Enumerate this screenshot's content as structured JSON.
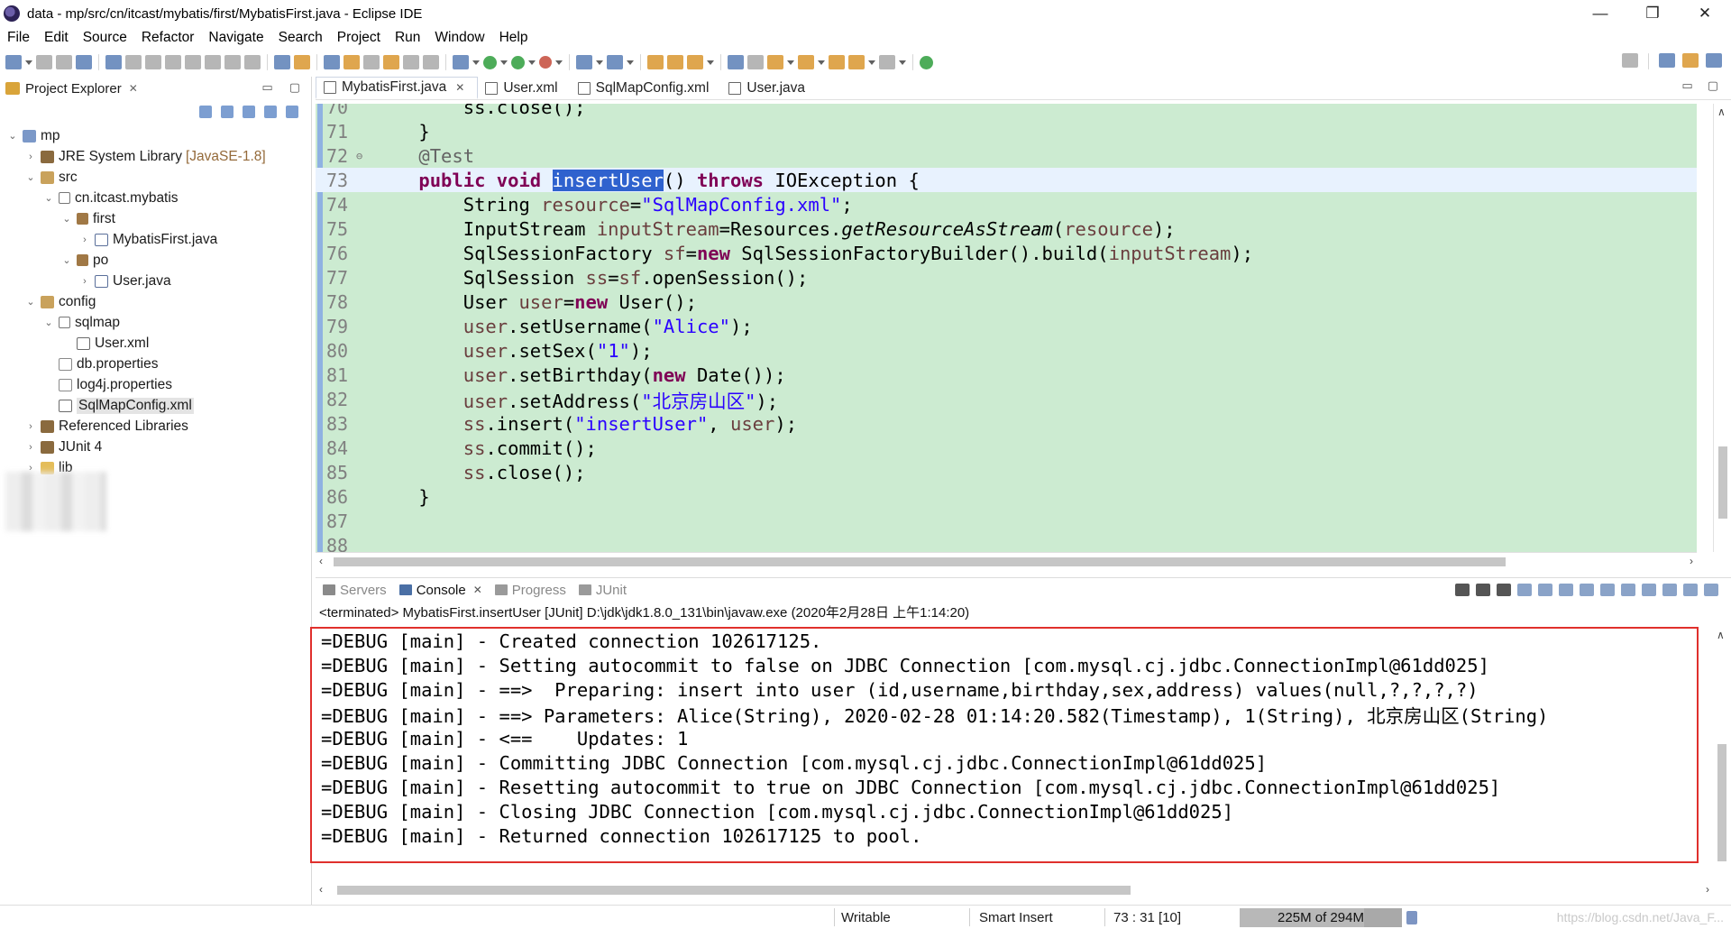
{
  "window": {
    "title": "data - mp/src/cn/itcast/mybatis/first/MybatisFirst.java - Eclipse IDE",
    "minimize": "—",
    "restore": "❐",
    "close": "✕"
  },
  "menu": [
    "File",
    "Edit",
    "Source",
    "Refactor",
    "Navigate",
    "Search",
    "Project",
    "Run",
    "Window",
    "Help"
  ],
  "explorer": {
    "title": "Project Explorer",
    "items": [
      {
        "label": "mp",
        "indent": 0,
        "twisty": "v",
        "icon": "proj"
      },
      {
        "label": "JRE System Library",
        "suffix": "[JavaSE-1.8]",
        "indent": 1,
        "twisty": ">",
        "icon": "lib"
      },
      {
        "label": "src",
        "indent": 1,
        "twisty": "v",
        "icon": "src"
      },
      {
        "label": "cn.itcast.mybatis",
        "indent": 2,
        "twisty": "v",
        "icon": "pkge"
      },
      {
        "label": "first",
        "indent": 3,
        "twisty": "v",
        "icon": "pkg"
      },
      {
        "label": "MybatisFirst.java",
        "indent": 4,
        "twisty": ">",
        "icon": "java"
      },
      {
        "label": "po",
        "indent": 3,
        "twisty": "v",
        "icon": "pkg"
      },
      {
        "label": "User.java",
        "indent": 4,
        "twisty": ">",
        "icon": "java"
      },
      {
        "label": "config",
        "indent": 1,
        "twisty": "v",
        "icon": "src"
      },
      {
        "label": "sqlmap",
        "indent": 2,
        "twisty": "v",
        "icon": "pkge"
      },
      {
        "label": "User.xml",
        "indent": 3,
        "twisty": "",
        "icon": "xml"
      },
      {
        "label": "db.properties",
        "indent": 2,
        "twisty": "",
        "icon": "prop"
      },
      {
        "label": "log4j.properties",
        "indent": 2,
        "twisty": "",
        "icon": "prop"
      },
      {
        "label": "SqlMapConfig.xml",
        "indent": 2,
        "twisty": "",
        "icon": "xml",
        "selected": true
      },
      {
        "label": "Referenced Libraries",
        "indent": 1,
        "twisty": ">",
        "icon": "lib"
      },
      {
        "label": "JUnit 4",
        "indent": 1,
        "twisty": ">",
        "icon": "lib"
      },
      {
        "label": "lib",
        "indent": 1,
        "twisty": ">",
        "icon": "fold"
      }
    ]
  },
  "editor": {
    "tabs": [
      {
        "label": "MybatisFirst.java",
        "active": true
      },
      {
        "label": "User.xml",
        "active": false
      },
      {
        "label": "SqlMapConfig.xml",
        "active": false
      },
      {
        "label": "User.java",
        "active": false
      }
    ],
    "lines": [
      {
        "num": "70",
        "fold": "",
        "tokens": [
          [
            "",
            "        ss.close();"
          ]
        ]
      },
      {
        "num": "71",
        "fold": "",
        "tokens": [
          [
            "",
            "    }"
          ]
        ]
      },
      {
        "num": "72",
        "fold": "⊖",
        "tokens": [
          [
            "ann",
            "    @Test"
          ]
        ]
      },
      {
        "num": "73",
        "fold": "",
        "current": true,
        "tokens": [
          [
            "",
            "    "
          ],
          [
            "kw",
            "public"
          ],
          [
            "",
            " "
          ],
          [
            "kw",
            "void"
          ],
          [
            "",
            " "
          ],
          [
            "sel",
            "insertUser"
          ],
          [
            "",
            "() "
          ],
          [
            "kw",
            "throws"
          ],
          [
            "",
            " IOException {"
          ]
        ]
      },
      {
        "num": "74",
        "fold": "",
        "tokens": [
          [
            "",
            "        String "
          ],
          [
            "fld",
            "resource"
          ],
          [
            "",
            "="
          ],
          [
            "str",
            "\"SqlMapConfig.xml\""
          ],
          [
            "",
            ";"
          ]
        ]
      },
      {
        "num": "75",
        "fold": "",
        "tokens": [
          [
            "",
            "        InputStream "
          ],
          [
            "fld",
            "inputStream"
          ],
          [
            "",
            "=Resources."
          ],
          [
            "it",
            "getResourceAsStream"
          ],
          [
            "",
            "("
          ],
          [
            "fld",
            "resource"
          ],
          [
            "",
            ");"
          ]
        ]
      },
      {
        "num": "76",
        "fold": "",
        "tokens": [
          [
            "",
            "        SqlSessionFactory "
          ],
          [
            "fld",
            "sf"
          ],
          [
            "",
            "="
          ],
          [
            "kw",
            "new"
          ],
          [
            "",
            " SqlSessionFactoryBuilder().build("
          ],
          [
            "fld",
            "inputStream"
          ],
          [
            "",
            ");"
          ]
        ]
      },
      {
        "num": "77",
        "fold": "",
        "tokens": [
          [
            "",
            "        SqlSession "
          ],
          [
            "fld",
            "ss"
          ],
          [
            "",
            "="
          ],
          [
            "fld",
            "sf"
          ],
          [
            "",
            ".openSession();"
          ]
        ]
      },
      {
        "num": "78",
        "fold": "",
        "tokens": [
          [
            "",
            "        User "
          ],
          [
            "fld",
            "user"
          ],
          [
            "",
            "="
          ],
          [
            "kw",
            "new"
          ],
          [
            "",
            " User();"
          ]
        ]
      },
      {
        "num": "79",
        "fold": "",
        "tokens": [
          [
            "",
            "        "
          ],
          [
            "fld",
            "user"
          ],
          [
            "",
            ".setUsername("
          ],
          [
            "str",
            "\"Alice\""
          ],
          [
            "",
            ");"
          ]
        ]
      },
      {
        "num": "80",
        "fold": "",
        "tokens": [
          [
            "",
            "        "
          ],
          [
            "fld",
            "user"
          ],
          [
            "",
            ".setSex("
          ],
          [
            "str",
            "\"1\""
          ],
          [
            "",
            ");"
          ]
        ]
      },
      {
        "num": "81",
        "fold": "",
        "tokens": [
          [
            "",
            "        "
          ],
          [
            "fld",
            "user"
          ],
          [
            "",
            ".setBirthday("
          ],
          [
            "kw",
            "new"
          ],
          [
            "",
            " Date());"
          ]
        ]
      },
      {
        "num": "82",
        "fold": "",
        "tokens": [
          [
            "",
            "        "
          ],
          [
            "fld",
            "user"
          ],
          [
            "",
            ".setAddress("
          ],
          [
            "str",
            "\"北京房山区\""
          ],
          [
            "",
            ");"
          ]
        ]
      },
      {
        "num": "83",
        "fold": "",
        "tokens": [
          [
            "",
            "        "
          ],
          [
            "fld",
            "ss"
          ],
          [
            "",
            ".insert("
          ],
          [
            "str",
            "\"insertUser\""
          ],
          [
            "",
            ", "
          ],
          [
            "fld",
            "user"
          ],
          [
            "",
            ");"
          ]
        ]
      },
      {
        "num": "84",
        "fold": "",
        "tokens": [
          [
            "",
            "        "
          ],
          [
            "fld",
            "ss"
          ],
          [
            "",
            ".commit();"
          ]
        ]
      },
      {
        "num": "85",
        "fold": "",
        "tokens": [
          [
            "",
            "        "
          ],
          [
            "fld",
            "ss"
          ],
          [
            "",
            ".close();"
          ]
        ]
      },
      {
        "num": "86",
        "fold": "",
        "tokens": [
          [
            "",
            "    }"
          ]
        ]
      },
      {
        "num": "87",
        "fold": "",
        "tokens": [
          [
            "",
            ""
          ]
        ]
      },
      {
        "num": "88",
        "fold": "",
        "tokens": [
          [
            "",
            ""
          ]
        ]
      }
    ]
  },
  "console": {
    "tabs": [
      {
        "label": "Servers",
        "active": false
      },
      {
        "label": "Console",
        "active": true
      },
      {
        "label": "Progress",
        "active": false
      },
      {
        "label": "JUnit",
        "active": false
      }
    ],
    "terminated": "<terminated> MybatisFirst.insertUser [JUnit] D:\\jdk\\jdk1.8.0_131\\bin\\javaw.exe (2020年2月28日 上午1:14:20)",
    "lines": [
      "=DEBUG [main] - Created connection 102617125.",
      "=DEBUG [main] - Setting autocommit to false on JDBC Connection [com.mysql.cj.jdbc.ConnectionImpl@61dd025]",
      "=DEBUG [main] - ==>  Preparing: insert into user (id,username,birthday,sex,address) values(null,?,?,?,?)",
      "=DEBUG [main] - ==> Parameters: Alice(String), 2020-02-28 01:14:20.582(Timestamp), 1(String), 北京房山区(String)",
      "=DEBUG [main] - <==    Updates: 1",
      "=DEBUG [main] - Committing JDBC Connection [com.mysql.cj.jdbc.ConnectionImpl@61dd025]",
      "=DEBUG [main] - Resetting autocommit to true on JDBC Connection [com.mysql.cj.jdbc.ConnectionImpl@61dd025]",
      "=DEBUG [main] - Closing JDBC Connection [com.mysql.cj.jdbc.ConnectionImpl@61dd025]",
      "=DEBUG [main] - Returned connection 102617125 to pool."
    ]
  },
  "status": {
    "writable": "Writable",
    "insert_mode": "Smart Insert",
    "position": "73 : 31 [10]",
    "heap": "225M of 294M",
    "heap_used_fraction": 0.765,
    "watermark": "https://blog.csdn.net/Java_F..."
  },
  "colors": {
    "editor_bg": "#ccebd1",
    "highlight_border": "#e0302c",
    "keyword": "#7f0055",
    "string": "#2a00ff"
  }
}
